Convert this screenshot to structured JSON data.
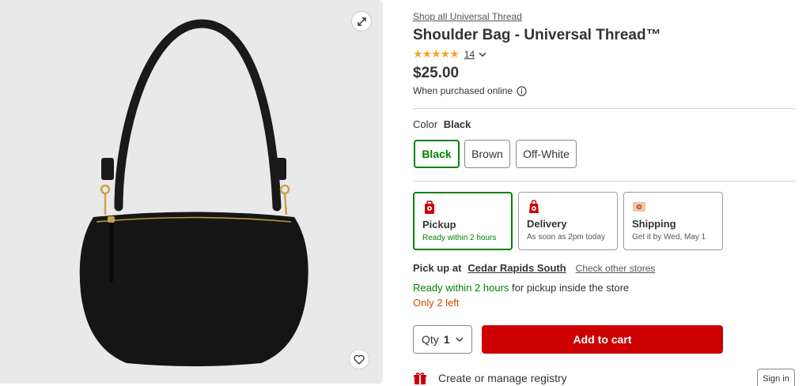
{
  "product": {
    "shop_link": "Shop all Universal Thread",
    "title": "Shoulder Bag - Universal Thread™",
    "rating_stars": "★★★★★",
    "rating_value": 5,
    "rating_count": "14",
    "price": "$25.00",
    "price_note": "When purchased online"
  },
  "color": {
    "label": "Color",
    "selected": "Black",
    "options": [
      "Black",
      "Brown",
      "Off-White"
    ]
  },
  "fulfillment": [
    {
      "name": "Pickup",
      "detail": "Ready within 2 hours"
    },
    {
      "name": "Delivery",
      "detail": "As soon as 2pm today"
    },
    {
      "name": "Shipping",
      "detail": "Get it by Wed, May 1"
    }
  ],
  "pickup": {
    "label": "Pick up at",
    "store": "Cedar Rapids South",
    "check_other": "Check other stores",
    "ready_green": "Ready within 2 hours",
    "ready_rest": "for pickup inside the store",
    "stock": "Only 2 left"
  },
  "cart": {
    "qty_label": "Qty",
    "qty_value": "1",
    "add_to_cart": "Add to cart"
  },
  "registry": {
    "label": "Create or manage registry",
    "sign_in": "Sign in"
  },
  "colors": {
    "brand_red": "#cc0000",
    "success_green": "#008300",
    "warning_orange": "#cc4b00",
    "star_gold": "#f5a623"
  },
  "icons": {
    "expand": "expand-icon",
    "favorite": "heart-icon",
    "info": "info-icon",
    "chevron": "chevron-down-icon",
    "pickup": "store-pickup-icon",
    "delivery": "delivery-icon",
    "shipping": "shipping-box-icon",
    "registry": "gift-icon"
  }
}
